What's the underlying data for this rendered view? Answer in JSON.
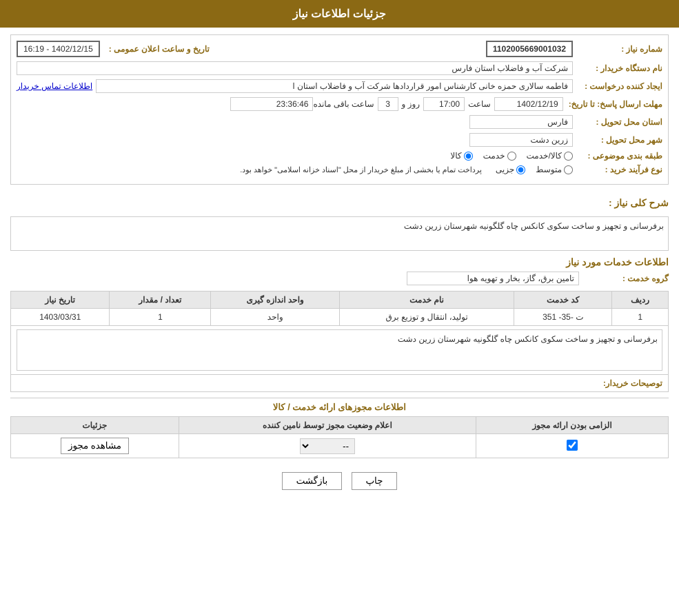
{
  "page": {
    "title": "جزئیات اطلاعات نیاز"
  },
  "header": {
    "labels": {
      "need_number": "شماره نیاز :",
      "buyer_name": "نام دستگاه خریدار :",
      "requester": "ایجاد کننده درخواست :",
      "response_deadline": "مهلت ارسال پاسخ: تا تاریخ:",
      "delivery_province": "استان محل تحویل :",
      "delivery_city": "شهر محل تحویل :",
      "category": "طبقه بندی موضوعی :",
      "purchase_type": "نوع فرآیند خرید :"
    }
  },
  "fields": {
    "need_number": "1102005669001032",
    "announce_date_label": "تاریخ و ساعت اعلان عمومی :",
    "announce_date_value": "1402/12/15 - 16:19",
    "buyer_name": "شرکت آب و فاضلاب استان فارس",
    "requester_name": "فاطمه سالاری حمزه خانی کارشناس امور قراردادها شرکت آب و فاضلاب استان ا",
    "requester_link": "اطلاعات تماس خریدار",
    "deadline_date": "1402/12/19",
    "deadline_time": "17:00",
    "deadline_days": "3",
    "deadline_remaining": "23:36:46",
    "delivery_province": "فارس",
    "delivery_city": "زرین دشت",
    "category_goods": "کالا",
    "category_service": "خدمت",
    "category_goods_service": "کالا/خدمت",
    "purchase_partial": "جزیی",
    "purchase_medium": "متوسط",
    "purchase_note": "پرداخت تمام یا بخشی از مبلغ خریدار از محل \"اسناد خزانه اسلامی\" خواهد بود."
  },
  "general_description": {
    "label": "شرح کلی نیاز :",
    "value": "برفرسانی و تجهیز و ساخت سکوی کانکس چاه گلگونیه شهرستان زرین دشت"
  },
  "services_section": {
    "title": "اطلاعات خدمات مورد نیاز",
    "service_group_label": "گروه خدمت :",
    "service_group_value": "تامین برق، گاز، بخار و تهویه هوا",
    "table": {
      "columns": [
        "ردیف",
        "کد خدمت",
        "نام خدمت",
        "واحد اندازه گیری",
        "تعداد / مقدار",
        "تاریخ نیاز"
      ],
      "rows": [
        {
          "row": "1",
          "code": "ت -35- 351",
          "name": "تولید، انتقال و توزیع برق",
          "unit": "واحد",
          "quantity": "1",
          "date": "1403/03/31"
        }
      ]
    }
  },
  "buyer_description": {
    "label": "توصیحات خریدار:",
    "value": "برفرسانی و تجهیز و ساخت سکوی کانکس چاه گلگونیه شهرستان زرین دشت"
  },
  "permissions_section": {
    "title": "اطلاعات مجوزهای ارائه خدمت / کالا",
    "table": {
      "columns": [
        "الزامی بودن ارائه مجوز",
        "اعلام وضعیت مجوز توسط نامین کننده",
        "جزئیات"
      ],
      "rows": [
        {
          "required": true,
          "status": "--",
          "details_btn": "مشاهده مجوز"
        }
      ]
    }
  },
  "buttons": {
    "print": "چاپ",
    "back": "بازگشت"
  }
}
